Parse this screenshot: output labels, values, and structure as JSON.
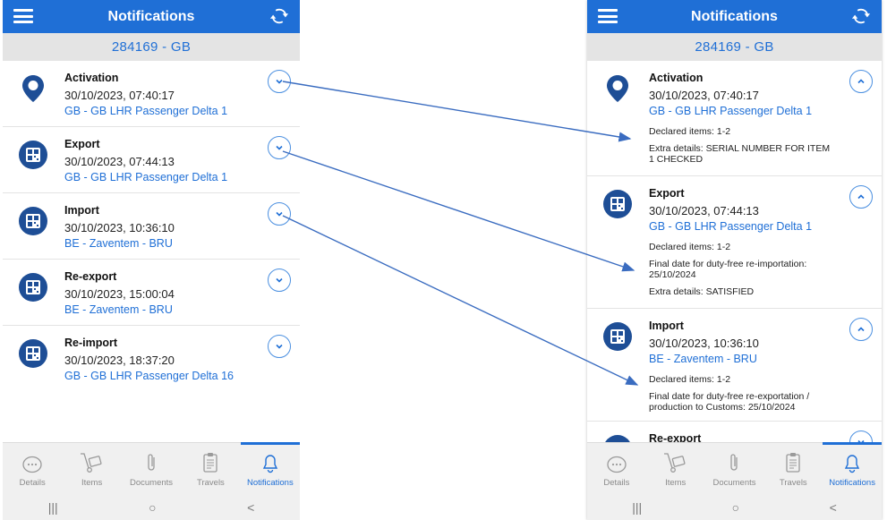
{
  "left": {
    "title": "Notifications",
    "code": "284169 - GB",
    "items": [
      {
        "name": "Activation",
        "date": "30/10/2023, 07:40:17",
        "location": "GB - GB LHR Passenger Delta 1",
        "icon": "location-pin-icon"
      },
      {
        "name": "Export",
        "date": "30/10/2023, 07:44:13",
        "location": "GB - GB LHR Passenger Delta 1",
        "icon": "qr-code-icon"
      },
      {
        "name": "Import",
        "date": "30/10/2023, 10:36:10",
        "location": "BE - Zaventem - BRU",
        "icon": "qr-code-icon"
      },
      {
        "name": "Re-export",
        "date": "30/10/2023, 15:00:04",
        "location": "BE - Zaventem - BRU",
        "icon": "qr-code-icon"
      },
      {
        "name": "Re-import",
        "date": "30/10/2023, 18:37:20",
        "location": "GB - GB LHR Passenger Delta 16",
        "icon": "qr-code-icon"
      }
    ]
  },
  "right": {
    "title": "Notifications",
    "code": "284169 - GB",
    "items": [
      {
        "name": "Activation",
        "date": "30/10/2023, 07:40:17",
        "location": "GB - GB LHR Passenger Delta 1",
        "declared": "Declared items: 1-2",
        "detail1": "Extra details: SERIAL NUMBER FOR ITEM 1 CHECKED"
      },
      {
        "name": "Export",
        "date": "30/10/2023, 07:44:13",
        "location": "GB - GB LHR Passenger Delta 1",
        "declared": "Declared items: 1-2",
        "detail1": "Final date for duty-free re-importation: 25/10/2024",
        "detail2": "Extra details: SATISFIED"
      },
      {
        "name": "Import",
        "date": "30/10/2023, 10:36:10",
        "location": "BE - Zaventem - BRU",
        "declared": "Declared items: 1-2",
        "detail1": "Final date for duty-free re-exportation / production to Customs: 25/10/2024"
      },
      {
        "name": "Re-export"
      }
    ]
  },
  "nav": {
    "details": "Details",
    "items": "Items",
    "documents": "Documents",
    "travels": "Travels",
    "notifications": "Notifications"
  },
  "sys": {
    "recents": "|||",
    "home": "○",
    "back": "<"
  },
  "colors": {
    "primary": "#1f6fd6",
    "subheader": "#e4e4e4",
    "navbar": "#f0f0f0"
  }
}
